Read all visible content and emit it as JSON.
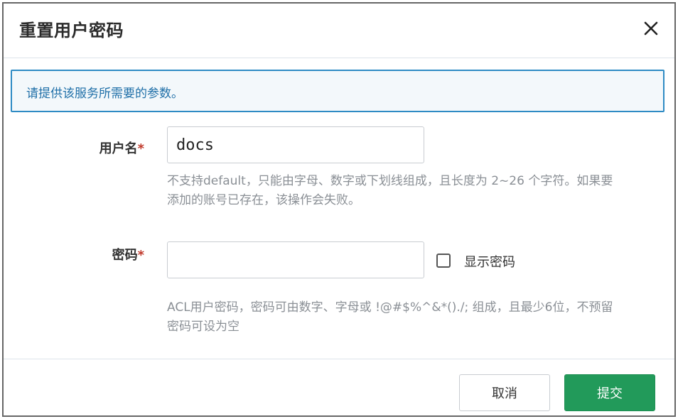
{
  "dialog": {
    "title": "重置用户密码",
    "close_icon": "close-icon"
  },
  "info": {
    "text": "请提供该服务所需要的参数。"
  },
  "form": {
    "username": {
      "label": "用户名",
      "required_mark": "*",
      "value": "docs",
      "hint_line1": "不支持default，只能由字母、数字或下划线组成，且长度为 2~26 个字符。如果要",
      "hint_line2": "添加的账号已存在，该操作会失败。"
    },
    "password": {
      "label": "密码",
      "required_mark": "*",
      "value": "",
      "show_password_label": "显示密码",
      "show_password_checked": false,
      "hint_line1": "ACL用户密码，密码可由数字、字母或 !@#$%^&*()./; 组成，且最少6位，不预留",
      "hint_line2": "密码可设为空"
    }
  },
  "footer": {
    "cancel_label": "取消",
    "submit_label": "提交"
  },
  "colors": {
    "accent": "#2e8bc4",
    "submit": "#229a5a",
    "required": "#c0392b"
  }
}
